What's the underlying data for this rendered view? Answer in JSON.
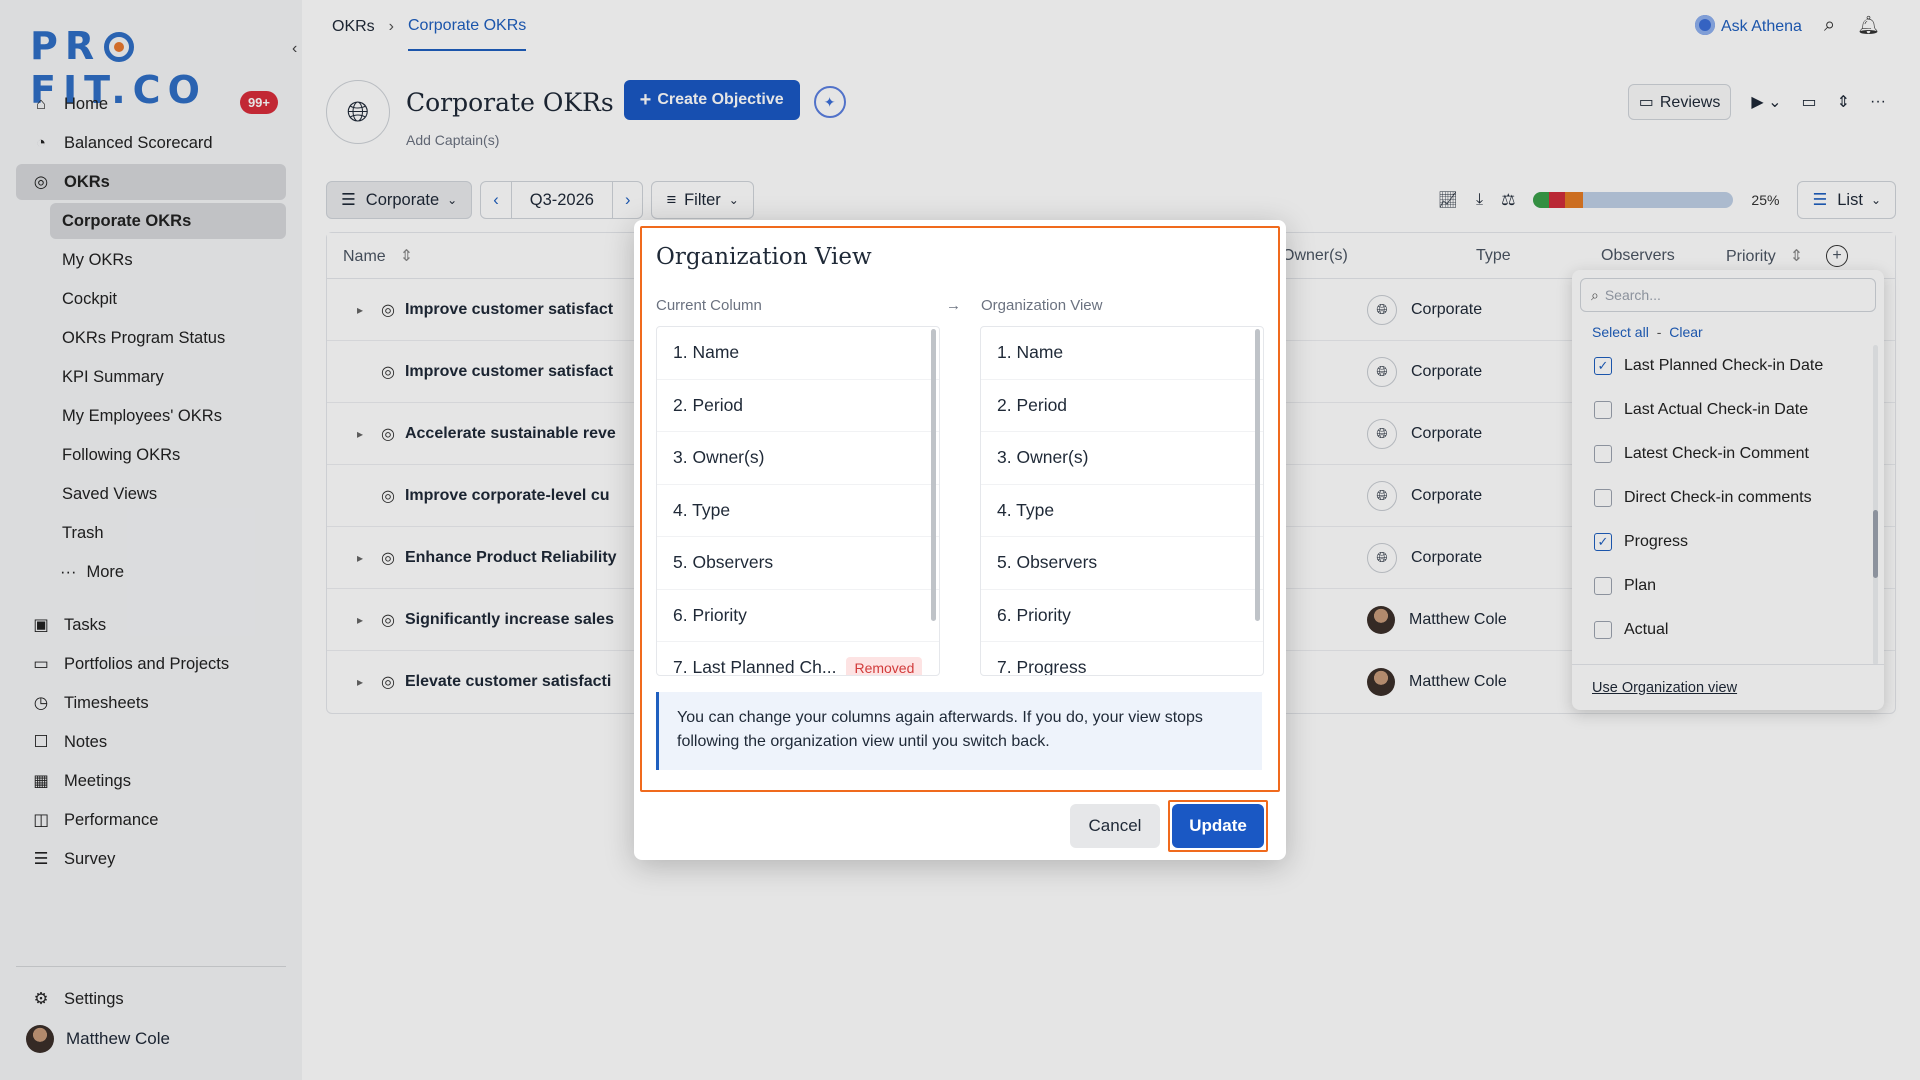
{
  "brand": {
    "logo_text_1": "PR",
    "logo_text_2": "FIT.CO"
  },
  "sidebar": {
    "home": "Home",
    "home_badge": "99+",
    "balanced": "Balanced Scorecard",
    "okrs": "OKRs",
    "sub": [
      "Corporate OKRs",
      "My OKRs",
      "Cockpit",
      "OKRs Program Status",
      "KPI Summary",
      "My Employees' OKRs",
      "Following OKRs",
      "Saved Views",
      "Trash"
    ],
    "more": "More",
    "tasks": "Tasks",
    "portfolios": "Portfolios and Projects",
    "timesheets": "Timesheets",
    "notes": "Notes",
    "meetings": "Meetings",
    "performance": "Performance",
    "survey": "Survey",
    "settings": "Settings",
    "user": "Matthew Cole"
  },
  "topbar": {
    "crumb_root": "OKRs",
    "crumb_current": "Corporate OKRs",
    "ask": "Ask Athena"
  },
  "header": {
    "title": "Corporate OKRs",
    "captain": "Add Captain(s)",
    "create": "Create Objective",
    "reviews": "Reviews"
  },
  "toolbar": {
    "scope": "Corporate",
    "period": "Q3-2026",
    "filter": "Filter",
    "progress_pct": "25%",
    "view": "List"
  },
  "progress": {
    "segments": [
      {
        "color": "#3aa04a",
        "value": 8
      },
      {
        "color": "#d02d3c",
        "value": 8
      },
      {
        "color": "#e47b24",
        "value": 9
      }
    ]
  },
  "table": {
    "col_name": "Name",
    "col_owners": "Owner(s)",
    "col_type": "Type",
    "col_observers": "Observers",
    "col_priority": "Priority",
    "rows": [
      {
        "name": "Improve customer satisfact",
        "owner": "Corporate"
      },
      {
        "name": "Improve customer satisfact",
        "owner": "Corporate"
      },
      {
        "name": "Accelerate sustainable reve",
        "owner": "Corporate"
      },
      {
        "name": "Improve corporate-level cu",
        "owner": "Corporate"
      },
      {
        "name": "Enhance Product Reliability",
        "owner": "Corporate"
      },
      {
        "name": "Significantly increase sales",
        "owner": "Matthew Cole"
      },
      {
        "name": "Elevate customer satisfacti",
        "owner": "Matthew Cole"
      }
    ]
  },
  "column_panel": {
    "search_placeholder": "Search...",
    "select_all": "Select all",
    "dash": "-",
    "clear": "Clear",
    "items": [
      {
        "label": "Last Planned Check-in Date",
        "checked": true
      },
      {
        "label": "Last Actual Check-in Date",
        "checked": false
      },
      {
        "label": "Latest Check-in Comment",
        "checked": false
      },
      {
        "label": "Direct Check-in comments",
        "checked": false
      },
      {
        "label": "Progress",
        "checked": true
      },
      {
        "label": "Plan",
        "checked": false
      },
      {
        "label": "Actual",
        "checked": false
      }
    ],
    "footer": "Use Organization view"
  },
  "modal": {
    "title": "Organization View",
    "left_label": "Current Column",
    "right_label": "Organization View",
    "left": [
      "1. Name",
      "2. Period",
      "3. Owner(s)",
      "4. Type",
      "5. Observers",
      "6. Priority",
      "7. Last Planned Ch..."
    ],
    "removed": "Removed",
    "right": [
      "1. Name",
      "2. Period",
      "3. Owner(s)",
      "4. Type",
      "5. Observers",
      "6. Priority",
      "7. Progress"
    ],
    "info": "You can change your columns again afterwards. If you do, your view stops following the organization view until you switch back.",
    "cancel": "Cancel",
    "update": "Update"
  }
}
